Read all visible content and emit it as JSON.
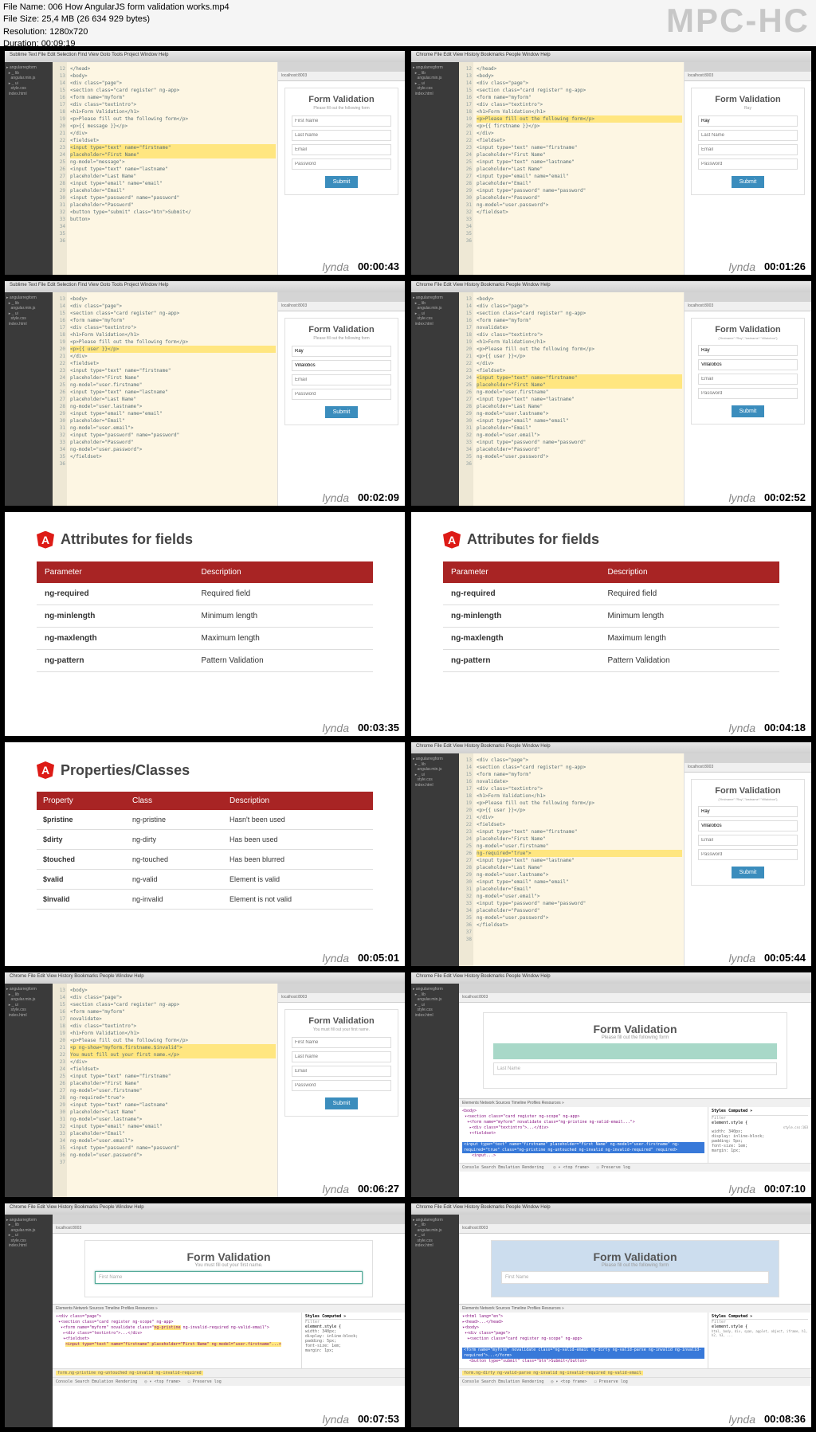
{
  "file": {
    "name_label": "File Name: 006 How AngularJS form validation works.mp4",
    "size_label": "File Size: 25,4 MB (26 634 929 bytes)",
    "resolution_label": "Resolution: 1280x720",
    "duration_label": "Duration: 00:09:19"
  },
  "watermark": "MPC-HC",
  "lynda": "lynda",
  "macbar": "Sublime Text   File   Edit   Selection   Find   View   Goto   Tools   Project   Window   Help",
  "chromebar": "Chrome   File   Edit   View   History   Bookmarks   People   Window   Help",
  "addr": "localhost:8003",
  "form": {
    "title": "Form Validation",
    "sub": "Please fill out the following form",
    "sub_err": "You must fill out your first name.",
    "sub_model": "{\"firstname\":\"Ray\",\"lastname\":\"Villalobos\"}",
    "ph_first": "First Name",
    "ph_last": "Last Name",
    "ph_email": "Email",
    "ph_pass": "Password",
    "val_ray": "Ray",
    "val_vill": "Villalobos",
    "submit": "Submit"
  },
  "timestamps": [
    "00:00:43",
    "00:01:26",
    "00:02:09",
    "00:02:52",
    "00:03:35",
    "00:04:18",
    "00:05:01",
    "00:05:44",
    "00:06:27",
    "00:07:10",
    "00:07:53",
    "00:08:36"
  ],
  "slide_attr": {
    "title": "Attributes for fields",
    "th1": "Parameter",
    "th2": "Description",
    "rows": [
      {
        "p": "ng-required",
        "d": "Required field"
      },
      {
        "p": "ng-minlength",
        "d": "Minimum length"
      },
      {
        "p": "ng-maxlength",
        "d": "Maximum length"
      },
      {
        "p": "ng-pattern",
        "d": "Pattern Validation"
      }
    ]
  },
  "slide_prop": {
    "title": "Properties/Classes",
    "th1": "Property",
    "th2": "Class",
    "th3": "Description",
    "rows": [
      {
        "p": "$pristine",
        "c": "ng-pristine",
        "d": "Hasn't been used"
      },
      {
        "p": "$dirty",
        "c": "ng-dirty",
        "d": "Has been used"
      },
      {
        "p": "$touched",
        "c": "ng-touched",
        "d": "Has been blurred"
      },
      {
        "p": "$valid",
        "c": "ng-valid",
        "d": "Element is valid"
      },
      {
        "p": "$invalid",
        "c": "ng-invalid",
        "d": "Element is not valid"
      }
    ]
  },
  "code": {
    "l12": "</head>",
    "l13": "<body>",
    "l14": "<div class=\"page\">",
    "l15": "  <section class=\"card register\" ng-app>",
    "l16": "  <form name=\"myform\"",
    "l16b": "    novalidate>",
    "l17": "",
    "l18": "    <div class=\"textintro\">",
    "l19": "      <h1>Form Validation</h1>",
    "l20": "      <p>Please fill out the following form</p>",
    "l21": "      <p>{{ message }}</p>",
    "l21b": "      <p>{{ user }}</p>",
    "l21c": "      <p>{{ firstname }}</p>",
    "l21d": "      <p ng-show=\"myform.firstname.$invalid\">",
    "l21e": "      You must fill out your first name.</p>",
    "l22": "    </div>",
    "l23": "",
    "l24": "    <fieldset>",
    "l25": "      <input type=\"text\" name=\"firstname\"",
    "l26": "        placeholder=\"First Name\"",
    "l26m": "        ng-model=\"message\">",
    "l26u": "        ng-model=\"user.firstname\"",
    "l26r": "        ng-required=\"true\">",
    "l27": "      <input type=\"text\" name=\"lastname\"",
    "l28": "        placeholder=\"Last Name\"",
    "l28u": "        ng-model=\"user.lastname\">",
    "l29": "      <input type=\"email\" name=\"email\"",
    "l30": "        placeholder=\"Email\"",
    "l30u": "        ng-model=\"user.email\">",
    "l31": "      <input type=\"password\" name=\"password\"",
    "l32": "        placeholder=\"Password\"",
    "l32u": "        ng-model=\"user.password\">",
    "l33": "    </fieldset>",
    "l34": "",
    "l35": "    <button type=\"submit\" class=\"btn\">Submit</",
    "l36": "    button>"
  },
  "devtools": {
    "tabs": "Elements   Network   Sources   Timeline   Profiles   Resources   »",
    "styles": "Styles   Computed   »",
    "filter": "Filter",
    "els": "element.style {",
    "css1": "width: 340px;\ndisplay: inline-block;\npadding: 5px;\nfont-size: 1em;\nmargin: 1px;",
    "classes": "form.ng-pristine ng-untouched ng-invalid ng-invalid-required",
    "classes2": "form.ng-dirty ng-valid-parse ng-invalid ng-invalid-required ng-valid-email",
    "console": "Console   Search   Emulation   Rendering",
    "preserve": "☐ Preserve log",
    "topframe": "<top frame>"
  },
  "sidebar": {
    "items": "▸ angularregform\n  ▸ _ lib\n    angular.min.js\n  ▸ _ ui\n    style.css\n  index.html"
  }
}
